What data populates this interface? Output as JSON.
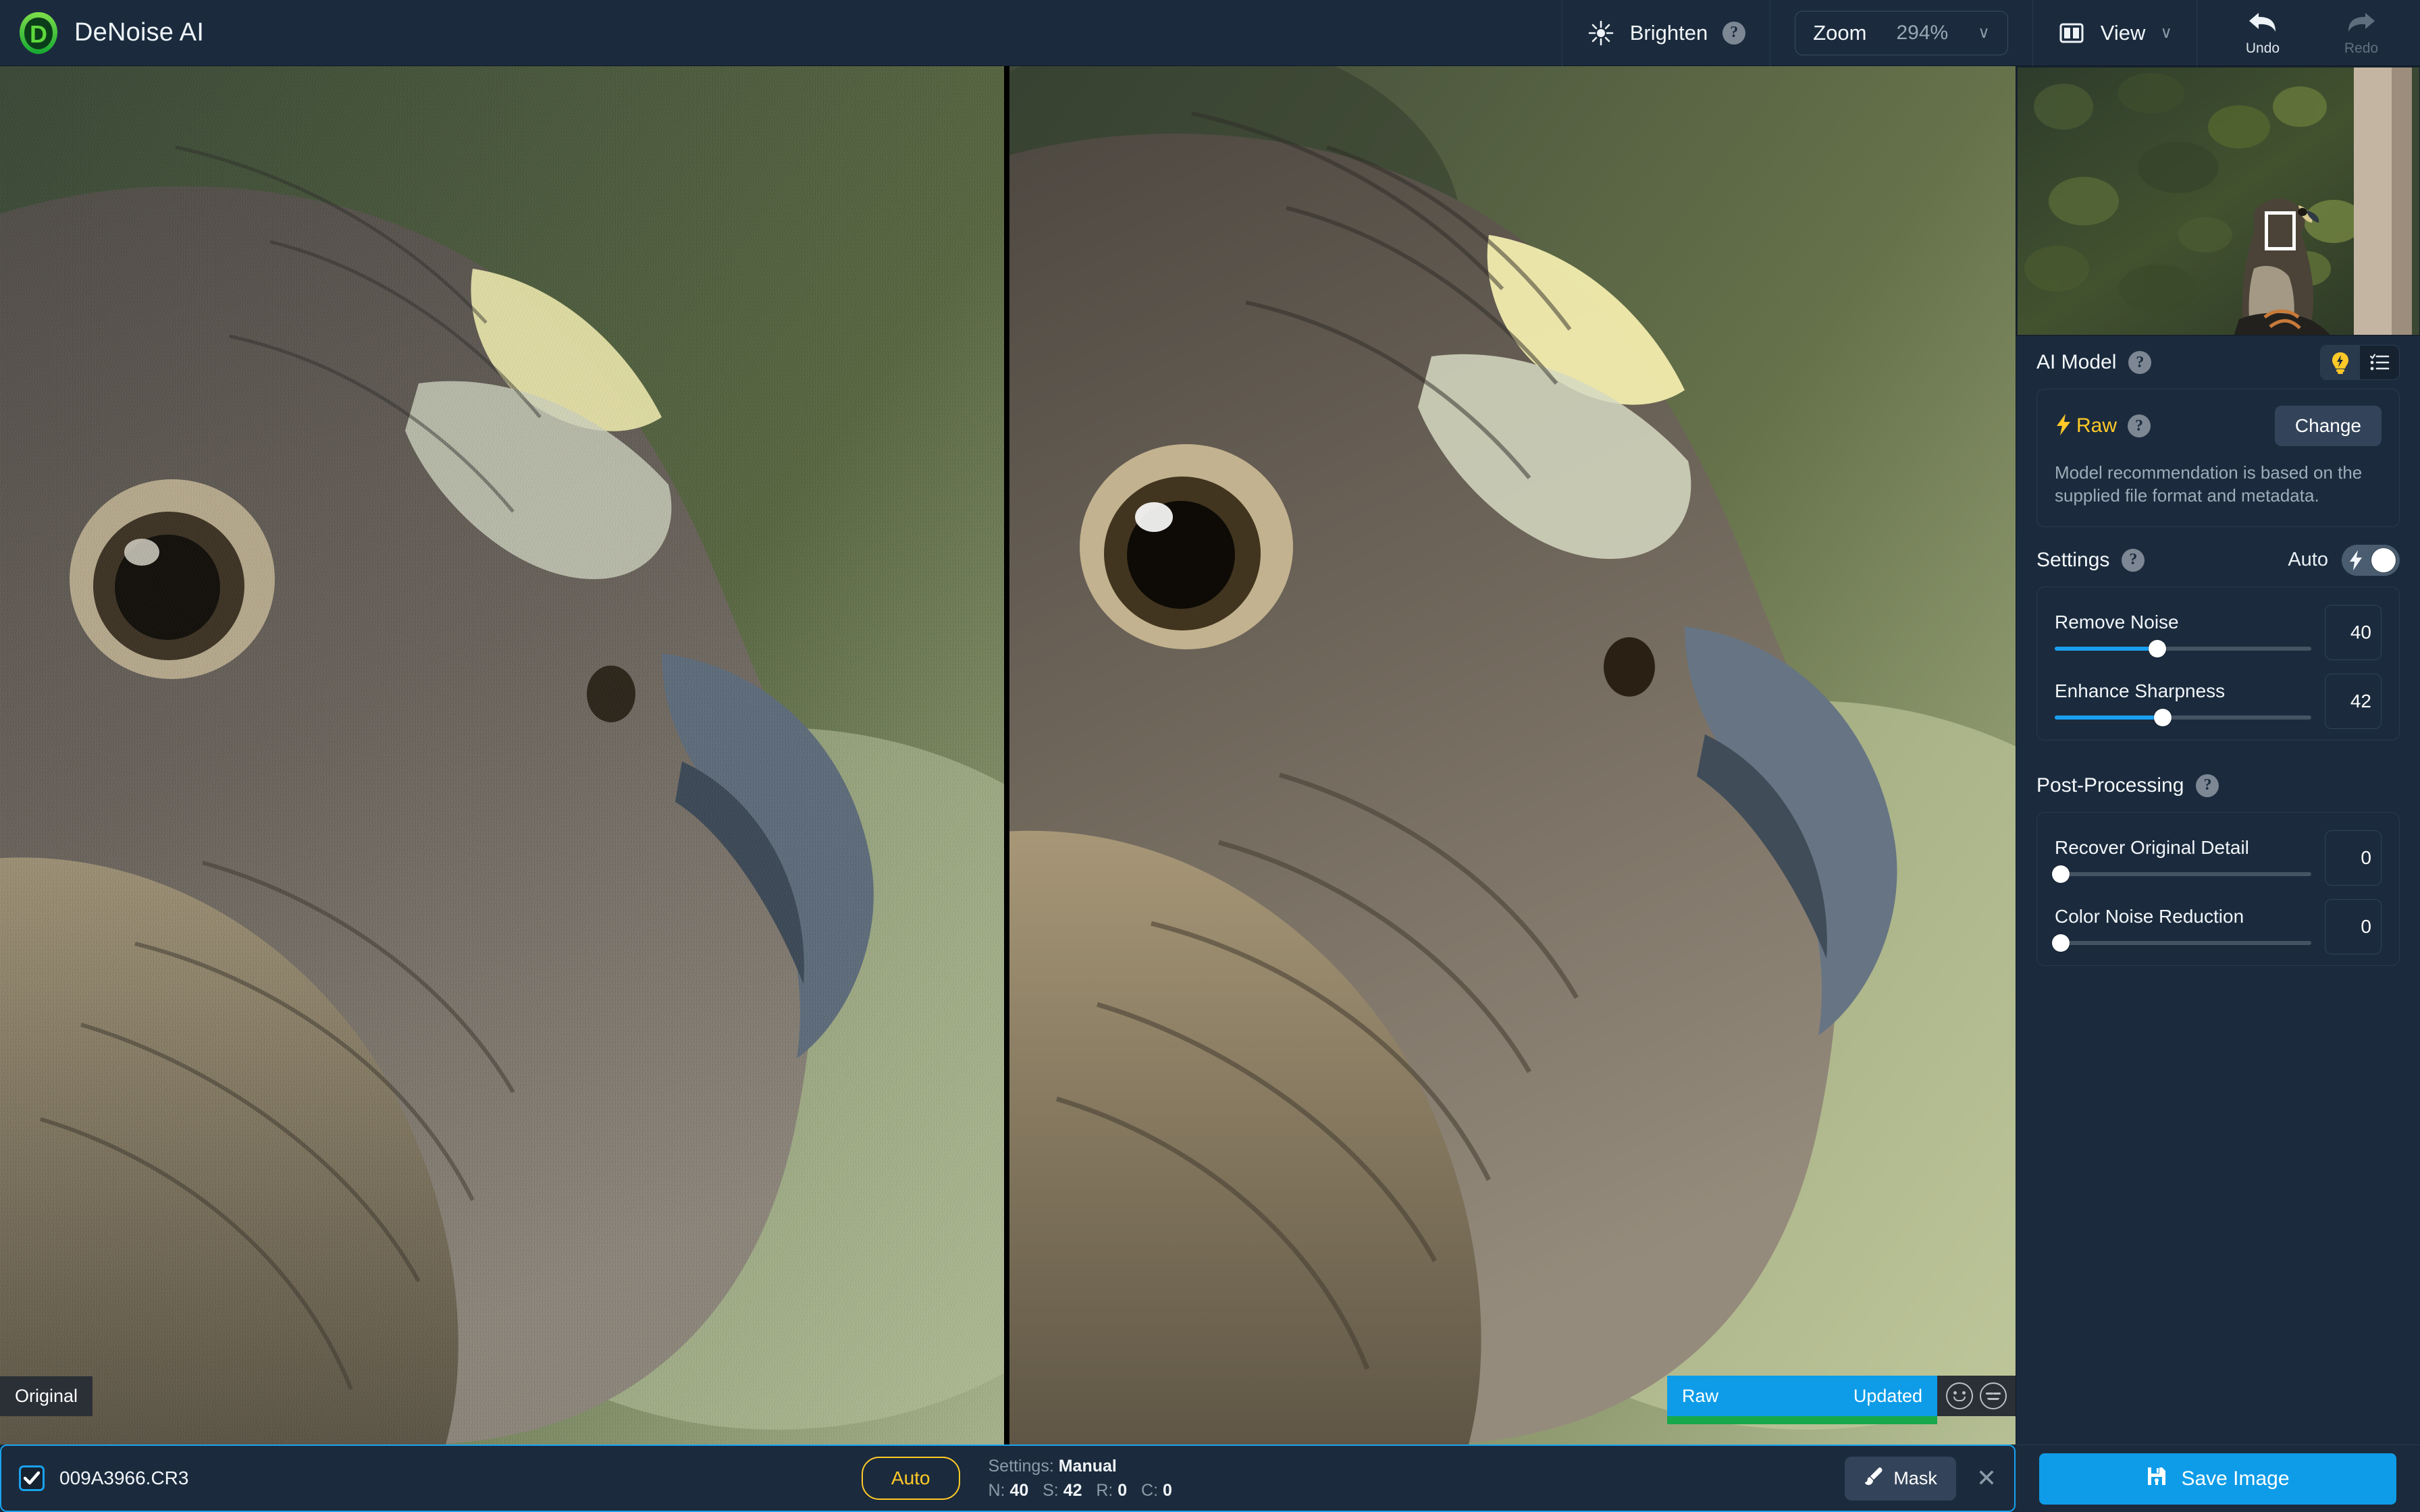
{
  "app": {
    "title": "DeNoise AI",
    "logo_icon": "topaz-d-logo-icon"
  },
  "toolbar": {
    "brighten": {
      "label": "Brighten",
      "icon": "brightness-icon",
      "help": "?"
    },
    "zoom": {
      "label": "Zoom",
      "value": "294%",
      "caret": "∨"
    },
    "view": {
      "label": "View",
      "icon": "split-view-icon",
      "caret": "∨"
    },
    "undo": {
      "label": "Undo",
      "icon": "undo-arrow-icon"
    },
    "redo": {
      "label": "Redo",
      "icon": "redo-arrow-icon"
    }
  },
  "preview": {
    "original_tag": "Original",
    "compare_left": "Raw",
    "compare_right": "Updated",
    "face_smile_icon": "smiley-face-icon",
    "face_neutral_icon": "neutral-face-icon",
    "navigator_icon": "navigator-thumbnail"
  },
  "panel": {
    "ai_model": {
      "title": "AI Model",
      "help": "?",
      "toggle_bulb_icon": "lightbulb-auto-icon",
      "toggle_list_icon": "list-view-icon",
      "model_name": "Raw",
      "model_icon": "lightning-bolt-icon",
      "model_help": "?",
      "change_label": "Change",
      "description": "Model recommendation is based on the supplied file format and metadata."
    },
    "settings": {
      "title": "Settings",
      "help": "?",
      "auto_label": "Auto",
      "auto_enabled": true,
      "sliders": [
        {
          "label": "Remove Noise",
          "value": 40,
          "percent": 40
        },
        {
          "label": "Enhance Sharpness",
          "value": 42,
          "percent": 42
        }
      ]
    },
    "post_processing": {
      "title": "Post-Processing",
      "help": "?",
      "sliders": [
        {
          "label": "Recover Original Detail",
          "value": 0,
          "percent": 0
        },
        {
          "label": "Color Noise Reduction",
          "value": 0,
          "percent": 0
        }
      ]
    }
  },
  "bottom": {
    "file_checked": true,
    "filename": "009A3966.CR3",
    "auto_label": "Auto",
    "settings_prefix": "Settings: ",
    "settings_mode": "Manual",
    "values": [
      {
        "key": "N:",
        "value": "40"
      },
      {
        "key": "S:",
        "value": "42"
      },
      {
        "key": "R:",
        "value": "0"
      },
      {
        "key": "C:",
        "value": "0"
      }
    ],
    "mask_label": "Mask",
    "mask_icon": "brush-icon",
    "close_icon": "close-x-icon",
    "save_label": "Save Image",
    "save_icon": "floppy-save-icon"
  },
  "colors": {
    "accent_blue": "#0e9ce8",
    "accent_yellow": "#ffc928",
    "progress_green": "#17a84b",
    "panel_bg": "#1b2b3d"
  }
}
